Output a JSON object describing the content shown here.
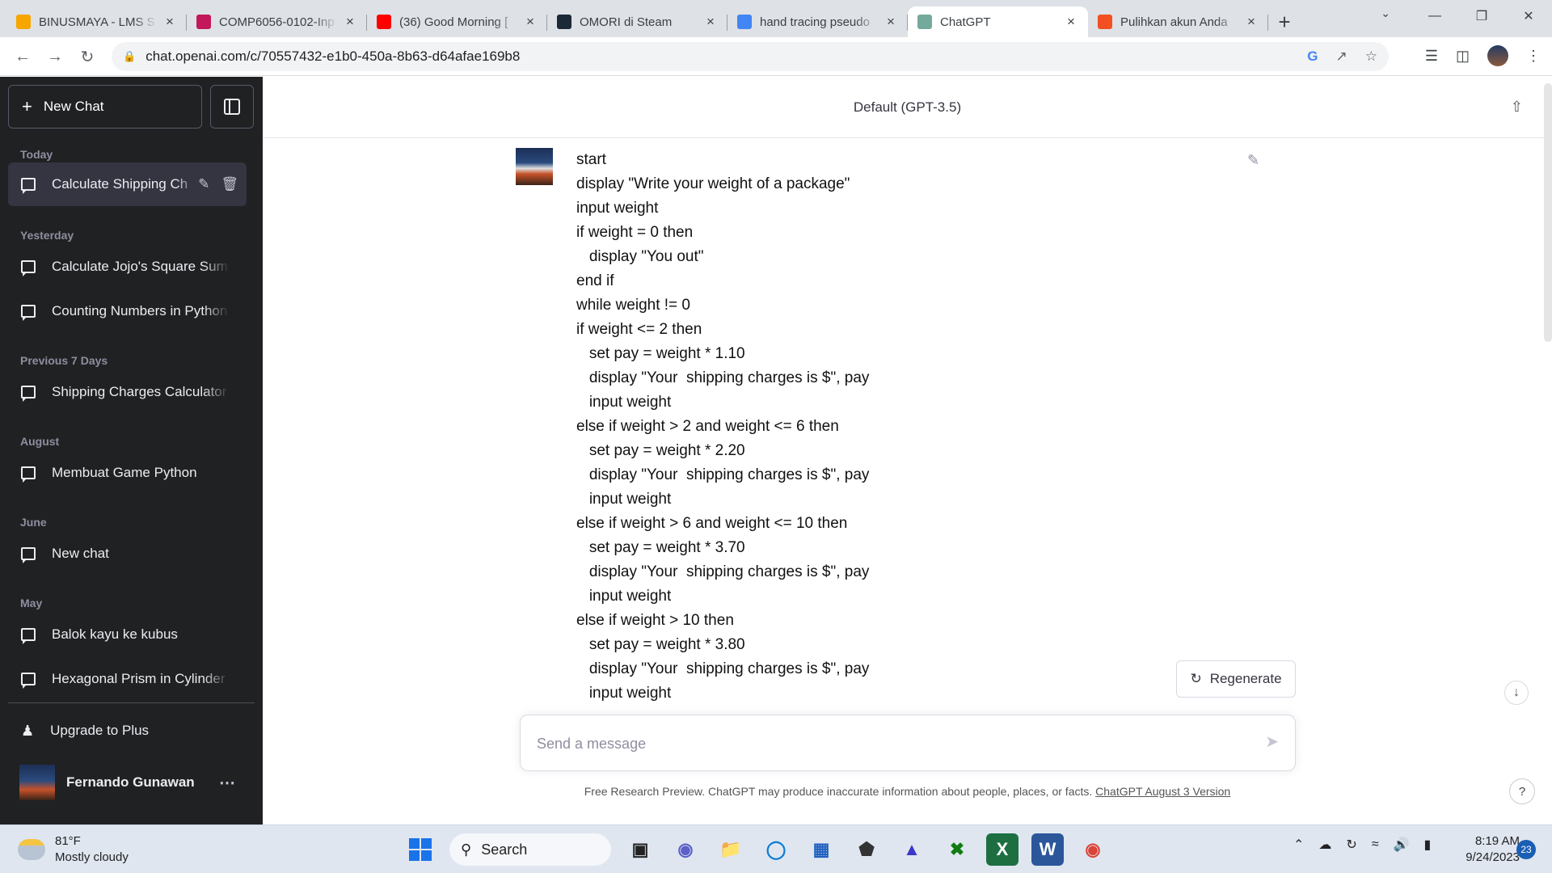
{
  "browser": {
    "tabs": [
      {
        "title": "BINUSMAYA - LMS S",
        "favicon_color": "#f7a600",
        "active": false
      },
      {
        "title": "COMP6056-0102-Inp",
        "favicon_color": "#c2185b",
        "active": false
      },
      {
        "title": "(36) Good Morning [",
        "favicon_color": "#ff0000",
        "active": false
      },
      {
        "title": "OMORI di Steam",
        "favicon_color": "#1b2838",
        "active": false
      },
      {
        "title": "hand tracing pseudo",
        "favicon_color": "#4285f4",
        "active": false
      },
      {
        "title": "ChatGPT",
        "favicon_color": "#74aa9c",
        "active": true
      },
      {
        "title": "Pulihkan akun Anda",
        "favicon_color": "#f25022",
        "active": false
      }
    ],
    "url": "chat.openai.com/c/70557432-e1b0-450a-8b63-d64afae169b8"
  },
  "sidebar": {
    "new_chat_label": "New Chat",
    "sections": [
      {
        "heading": "Today",
        "items": [
          "Calculate Shipping Ch"
        ]
      },
      {
        "heading": "Yesterday",
        "items": [
          "Calculate Jojo's Square Sum",
          "Counting Numbers in Python"
        ]
      },
      {
        "heading": "Previous 7 Days",
        "items": [
          "Shipping Charges Calculator"
        ]
      },
      {
        "heading": "August",
        "items": [
          "Membuat Game Python"
        ]
      },
      {
        "heading": "June",
        "items": [
          "New chat"
        ]
      },
      {
        "heading": "May",
        "items": [
          "Balok kayu ke kubus",
          "Hexagonal Prism in Cylinder"
        ]
      }
    ],
    "upgrade_label": "Upgrade to Plus",
    "user_name": "Fernando Gunawan"
  },
  "main": {
    "model_title": "Default (GPT-3.5)",
    "message_lines": [
      "start",
      "display \"Write your weight of a package\"",
      "input weight",
      "if weight = 0 then",
      "   display \"You out\"",
      "end if",
      "while weight != 0",
      "if weight <= 2 then",
      "   set pay = weight * 1.10",
      "   display \"Your  shipping charges is $\", pay",
      "   input weight",
      "else if weight > 2 and weight <= 6 then",
      "   set pay = weight * 2.20",
      "   display \"Your  shipping charges is $\", pay",
      "   input weight",
      "else if weight > 6 and weight <= 10 then",
      "   set pay = weight * 3.70",
      "   display \"Your  shipping charges is $\", pay",
      "   input weight",
      "else if weight > 10 then",
      "   set pay = weight * 3.80",
      "   display \"Your  shipping charges is $\", pay",
      "   input weight"
    ],
    "regenerate_label": "Regenerate",
    "composer_placeholder": "Send a message",
    "footer_text": "Free Research Preview. ChatGPT may produce inaccurate information about people, places, or facts. ",
    "footer_link": "ChatGPT August 3 Version",
    "help_label": "?"
  },
  "taskbar": {
    "temperature": "81°F",
    "weather": "Mostly cloudy",
    "search_label": "Search",
    "time": "8:19 AM",
    "date": "9/24/2023",
    "notification_count": "23"
  }
}
